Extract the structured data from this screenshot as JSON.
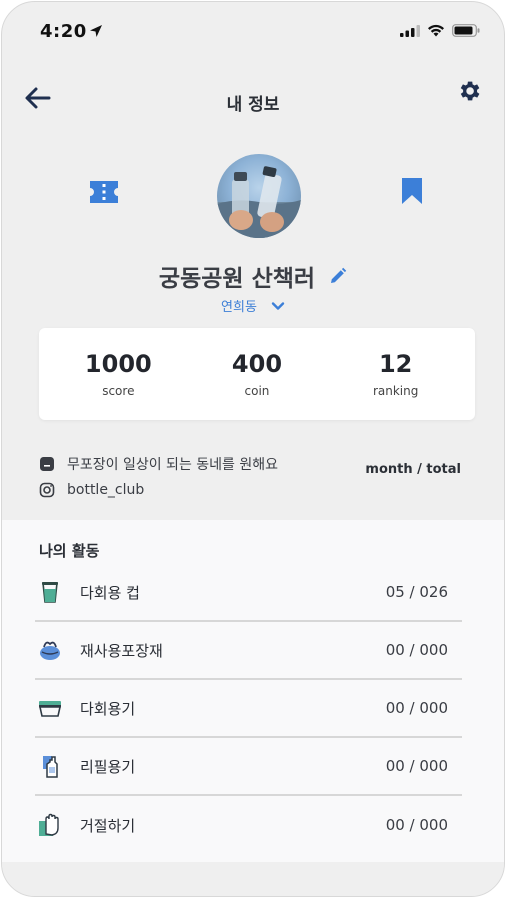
{
  "status": {
    "time": "4:20"
  },
  "header": {
    "title": "내 정보"
  },
  "profile": {
    "nickname": "궁동공원 산책러",
    "location": "연희동"
  },
  "stats": [
    {
      "value": "1000",
      "label": "score"
    },
    {
      "value": "400",
      "label": "coin"
    },
    {
      "value": "12",
      "label": "ranking"
    }
  ],
  "info": {
    "bio": "무포장이 일상이 되는 동네를 원해요",
    "instagram": "bottle_club",
    "period_toggle": "month / total"
  },
  "activity": {
    "title": "나의 활동",
    "items": [
      {
        "label": "다회용 컵",
        "count": "05 / 026",
        "icon": "cup-icon"
      },
      {
        "label": "재사용포장재",
        "count": "00 / 000",
        "icon": "wrap-bag-icon"
      },
      {
        "label": "다회용기",
        "count": "00 / 000",
        "icon": "container-icon"
      },
      {
        "label": "리필용기",
        "count": "00 / 000",
        "icon": "refill-bottle-icon"
      },
      {
        "label": "거절하기",
        "count": "00 / 000",
        "icon": "refuse-hand-icon"
      }
    ]
  },
  "colors": {
    "accent": "#3d7fd6",
    "icon_blue": "#3c7fd8",
    "dark_navy": "#1f2f4f",
    "background": "#efefef",
    "card": "#ffffff"
  }
}
